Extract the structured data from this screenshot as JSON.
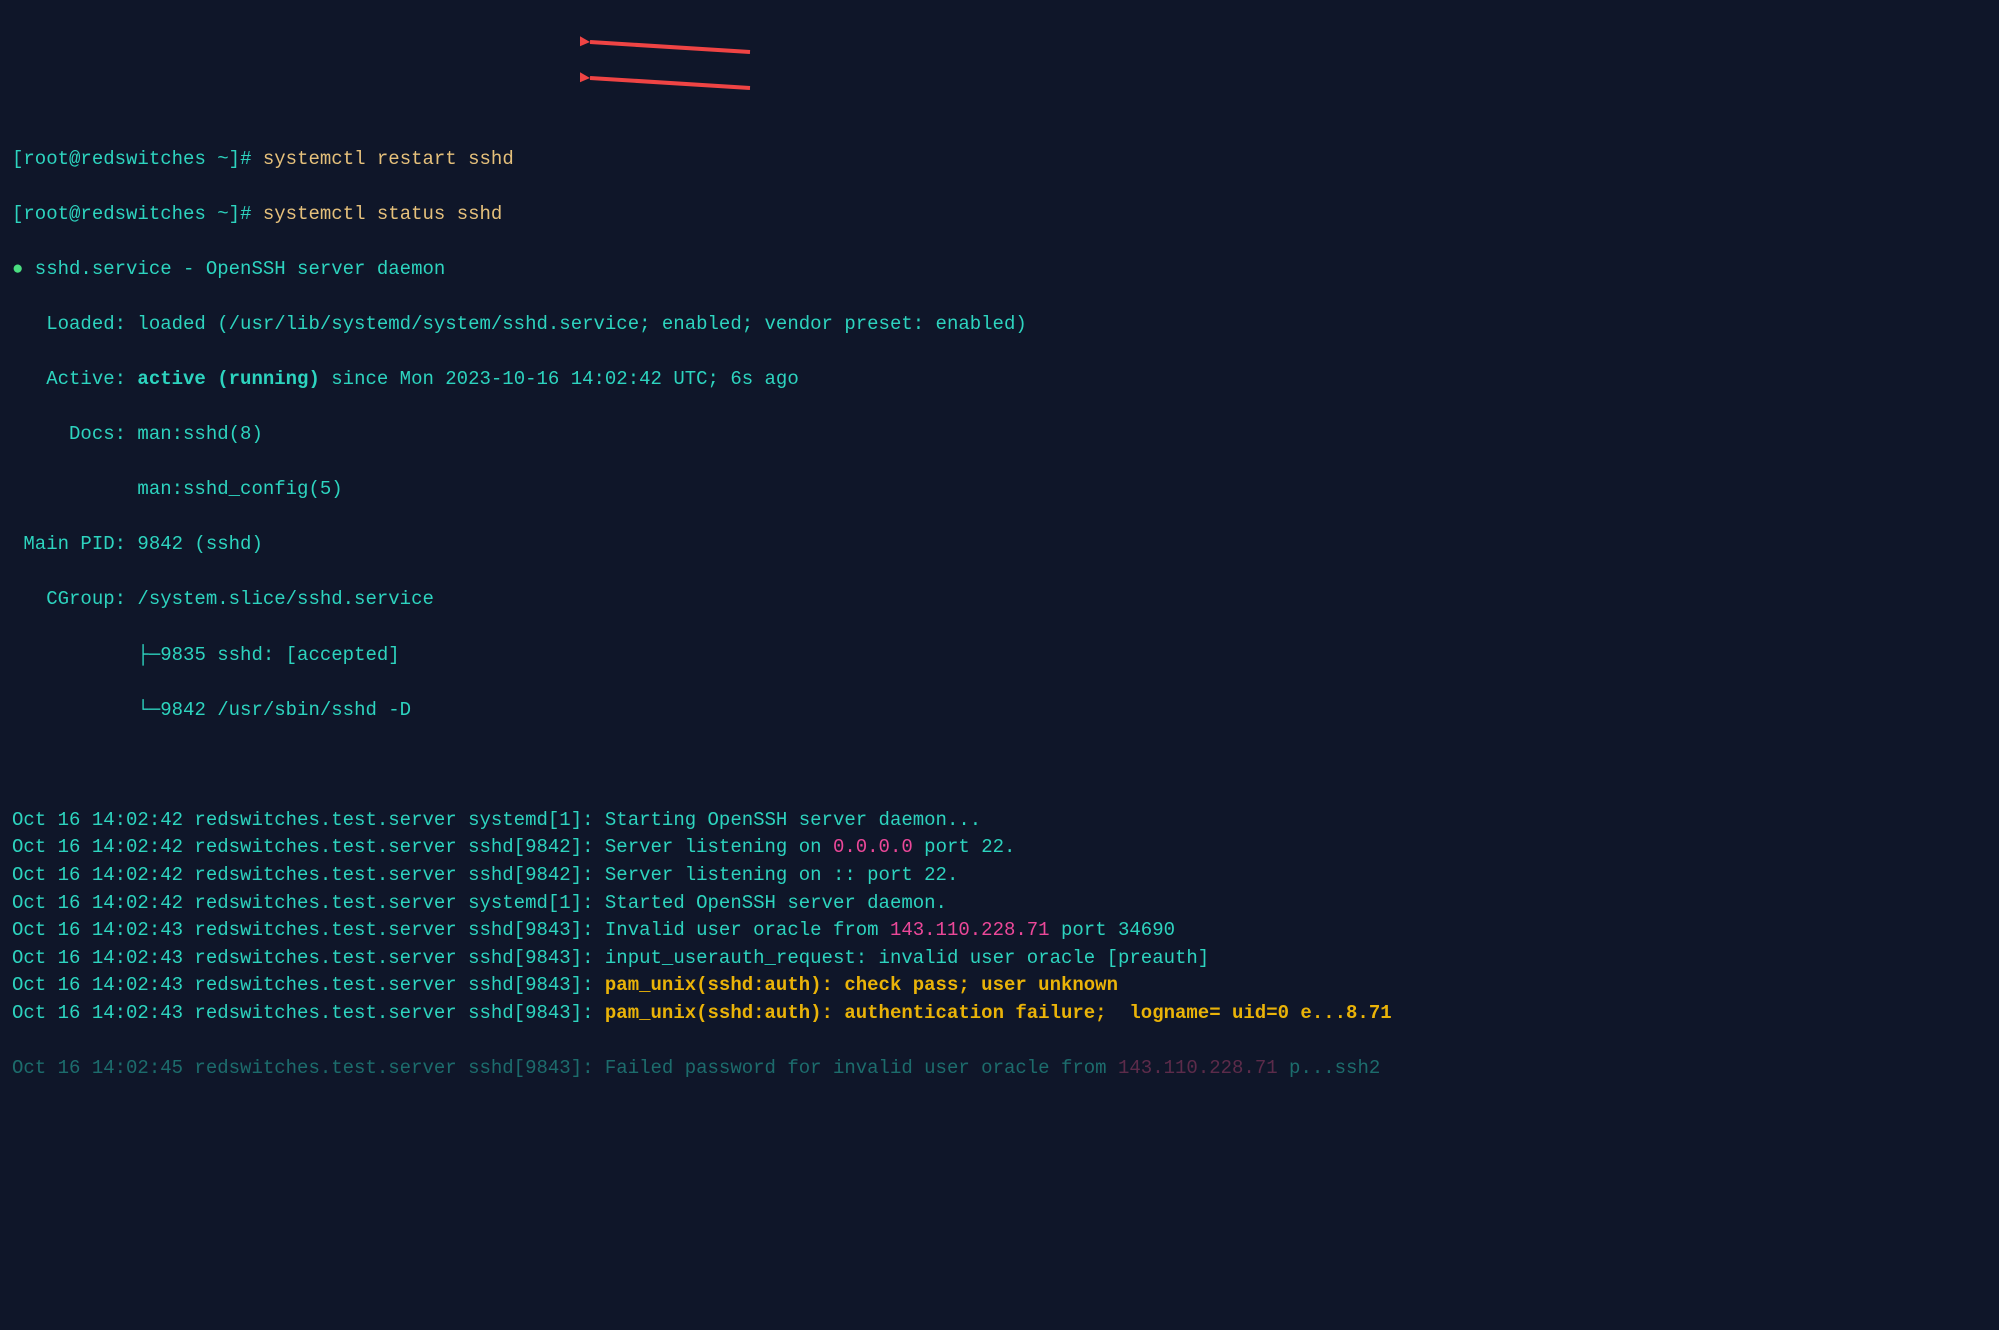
{
  "prompt": {
    "open": "[",
    "user": "root",
    "at": "@",
    "host": "redswitches",
    "path": " ~",
    "close": "]",
    "hash": "# "
  },
  "commands": {
    "restart": "systemctl restart sshd",
    "status": "systemctl status sshd"
  },
  "status": {
    "bullet": "●",
    "service": " sshd.service - OpenSSH server daemon",
    "loaded_label": "   Loaded: ",
    "loaded_value": "loaded (/usr/lib/systemd/system/sshd.service; enabled; vendor preset: enabled)",
    "active_label": "   Active: ",
    "active_value": "active (running)",
    "active_since": " since Mon 2023-10-16 14:02:42 UTC; 6s ago",
    "docs_label": "     Docs: ",
    "docs1": "man:sshd(8)",
    "docs2_pad": "           ",
    "docs2": "man:sshd_config(5)",
    "pid_label": " Main PID: ",
    "pid_value": "9842 (sshd)",
    "cgroup_label": "   CGroup: ",
    "cgroup_value": "/system.slice/sshd.service",
    "cgroup_child1_pad": "           ",
    "cgroup_child1_tree": "├─",
    "cgroup_child1": "9835 sshd: [accepted]",
    "cgroup_child2_pad": "           ",
    "cgroup_child2_tree": "└─",
    "cgroup_child2": "9842 /usr/sbin/sshd -D"
  },
  "logs": [
    {
      "ts": "Oct 16 14:02:42 redswitches.test.server systemd[1]: ",
      "msg": "Starting OpenSSH server daemon...",
      "ip": "",
      "tail": "",
      "bold": false
    },
    {
      "ts": "Oct 16 14:02:42 redswitches.test.server sshd[9842]: ",
      "msg": "Server listening on ",
      "ip": "0.0.0.0",
      "tail": " port 22.",
      "bold": false
    },
    {
      "ts": "Oct 16 14:02:42 redswitches.test.server sshd[9842]: ",
      "msg": "Server listening on :: port 22.",
      "ip": "",
      "tail": "",
      "bold": false
    },
    {
      "ts": "Oct 16 14:02:42 redswitches.test.server systemd[1]: ",
      "msg": "Started OpenSSH server daemon.",
      "ip": "",
      "tail": "",
      "bold": false
    },
    {
      "ts": "Oct 16 14:02:43 redswitches.test.server sshd[9843]: ",
      "msg": "Invalid user oracle from ",
      "ip": "143.110.228.71",
      "tail": " port 34690",
      "bold": false
    },
    {
      "ts": "Oct 16 14:02:43 redswitches.test.server sshd[9843]: ",
      "msg": "input_userauth_request: invalid user oracle [preauth]",
      "ip": "",
      "tail": "",
      "bold": false
    },
    {
      "ts": "Oct 16 14:02:43 redswitches.test.server sshd[9843]: ",
      "msg": "pam_unix(sshd:auth): check pass; user unknown",
      "ip": "",
      "tail": "",
      "bold": true
    },
    {
      "ts": "Oct 16 14:02:43 redswitches.test.server sshd[9843]: ",
      "msg": "pam_unix(sshd:auth): authentication failure;  logname= uid=0 e...8.71",
      "ip": "",
      "tail": "",
      "bold": true
    }
  ],
  "cutoff": {
    "ts": "Oct 16 14:02:45 redswitches.test.server sshd[9843]: ",
    "msg_a": "Failed password for invalid user oracle from ",
    "ip": "143.110.228.71",
    "msg_b": " p...ssh2"
  }
}
